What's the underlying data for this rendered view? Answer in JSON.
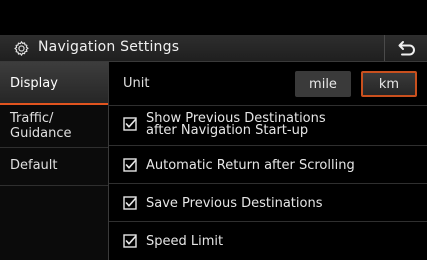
{
  "header": {
    "title": "Navigation Settings",
    "settings_icon": "gear-icon",
    "back_icon": "return-arrow-icon"
  },
  "sidebar": {
    "items": [
      {
        "label": "Display",
        "active": true
      },
      {
        "label": "Traffic/",
        "label2": "Guidance",
        "active": false
      },
      {
        "label": "Default",
        "active": false
      }
    ]
  },
  "main": {
    "unit": {
      "label": "Unit",
      "options": [
        "mile",
        "km"
      ],
      "selected": "km"
    },
    "options": [
      {
        "line1": "Show Previous Destinations",
        "line2": "after Navigation Start-up",
        "checked": true
      },
      {
        "line1": "Automatic Return after Scrolling",
        "checked": true
      },
      {
        "line1": "Save Previous Destinations",
        "checked": true
      },
      {
        "line1": "Speed Limit",
        "checked": true
      }
    ]
  },
  "colors": {
    "accent": "#e1541f",
    "background": "#000000"
  }
}
